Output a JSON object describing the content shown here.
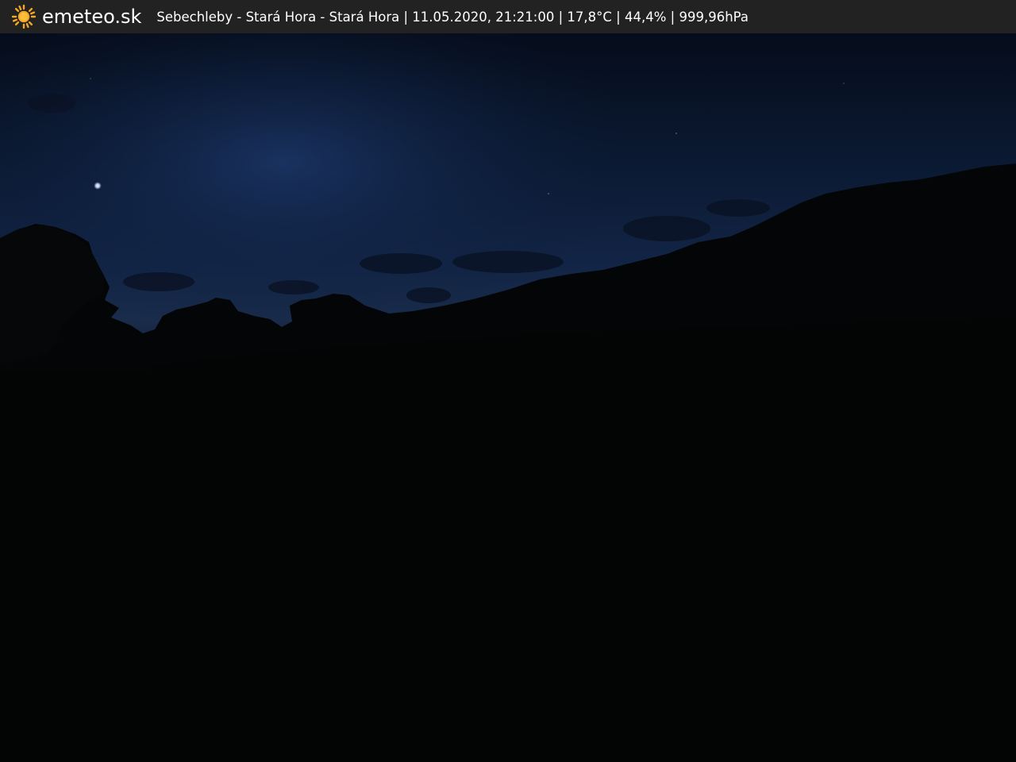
{
  "brand": {
    "name": "emeteo.sk",
    "icon": "sun-icon",
    "icon_color": "#f5a623"
  },
  "caption": {
    "location": "Sebechleby - Stará Hora - Stará Hora",
    "separator": " | ",
    "datetime": "11.05.2020, 21:21:00",
    "temperature": "17,8°C",
    "humidity": "44,4%",
    "pressure": "999,96hPa"
  },
  "colors": {
    "bar_background": "#222222",
    "bar_text": "#ffffff"
  }
}
